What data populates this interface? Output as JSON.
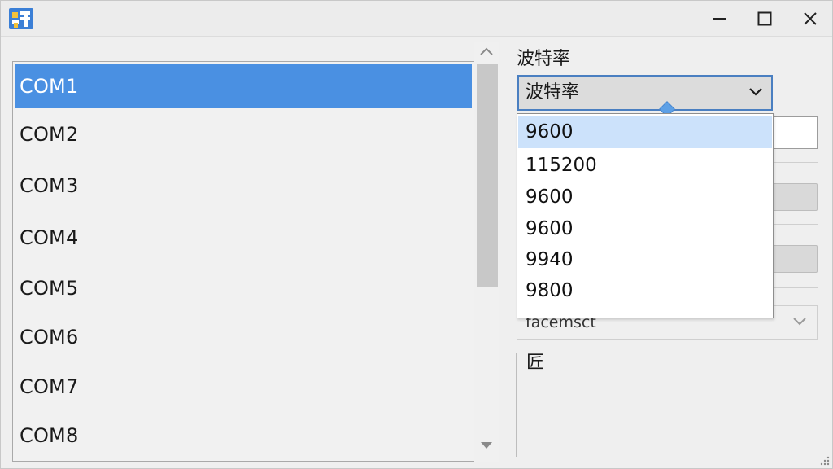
{
  "ports": {
    "items": [
      "COM1",
      "COM2",
      "COM3",
      "COM4",
      "COM5",
      "COM6",
      "COM7",
      "COM8"
    ],
    "selected_index": 0
  },
  "baud": {
    "group_title": "波特率",
    "combo_value": "波特率",
    "options": [
      "9600",
      "115200",
      "9600",
      "9600",
      "9940",
      "9800"
    ],
    "highlighted_index": 0
  },
  "lower": {
    "combo_value": "facemsct",
    "glyph_label": "匠"
  },
  "colors": {
    "selection": "#4a90e2",
    "highlight": "#cce2fb",
    "focus_border": "#4a7fc1"
  },
  "icons": {
    "app": "app-icon",
    "minimize": "minimize-icon",
    "maximize": "maximize-icon",
    "close": "close-icon",
    "chevron": "chevron-down-icon"
  }
}
